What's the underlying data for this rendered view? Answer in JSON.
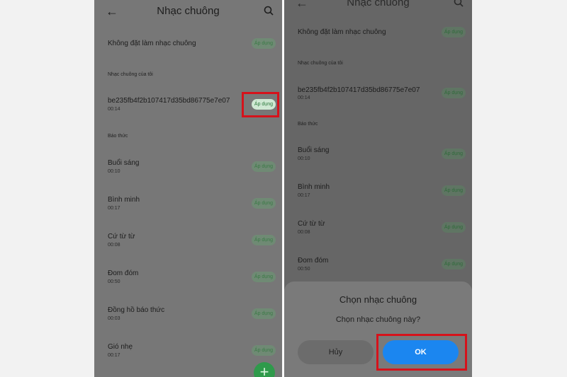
{
  "colors": {
    "accent_green": "#2f9a4b",
    "ok_blue": "#1b86f0",
    "highlight_red": "#d6121b"
  },
  "left": {
    "header": {
      "title": "Nhạc chuông",
      "back_icon": "arrow-left-icon",
      "search_icon": "search-icon"
    },
    "top_item": {
      "name": "Không đặt làm nhạc chuông",
      "apply": "Áp dụng"
    },
    "section_mine": "Nhạc chuông của tôi",
    "mine": {
      "name": "be235fb4f2b107417d35bd86775e7e07",
      "duration": "00:14",
      "apply": "Áp dụng"
    },
    "section_alarm": "Báo thức",
    "alarms": [
      {
        "name": "Buổi sáng",
        "duration": "00:10",
        "apply": "Áp dụng"
      },
      {
        "name": "Bình minh",
        "duration": "00:17",
        "apply": "Áp dụng"
      },
      {
        "name": "Cứ từ từ",
        "duration": "00:08",
        "apply": "Áp dụng"
      },
      {
        "name": "Đom đóm",
        "duration": "00:50",
        "apply": "Áp dụng"
      },
      {
        "name": "Đồng hồ báo thức",
        "duration": "00:03",
        "apply": "Áp dụng"
      },
      {
        "name": "Gió nhẹ",
        "duration": "00:17",
        "apply": "Áp dụng"
      }
    ],
    "fab": "+"
  },
  "right": {
    "header": {
      "title": "Nhạc chuông"
    },
    "top_item": {
      "name": "Không đặt làm nhạc chuông",
      "apply": "Áp dụng"
    },
    "section_mine": "Nhạc chuông của tôi",
    "mine": {
      "name": "be235fb4f2b107417d35bd86775e7e07",
      "duration": "00:14",
      "apply": "Áp dụng"
    },
    "section_alarm": "Báo thức",
    "alarms": [
      {
        "name": "Buổi sáng",
        "duration": "00:10",
        "apply": "Áp dụng"
      },
      {
        "name": "Bình minh",
        "duration": "00:17",
        "apply": "Áp dụng"
      },
      {
        "name": "Cứ từ từ",
        "duration": "00:08",
        "apply": "Áp dụng"
      },
      {
        "name": "Đom đóm",
        "duration": "00:50",
        "apply": "Áp dụng"
      }
    ],
    "dialog": {
      "title": "Chọn nhạc chuông",
      "message": "Chọn nhạc chuông này?",
      "cancel": "Hủy",
      "ok": "OK"
    }
  }
}
